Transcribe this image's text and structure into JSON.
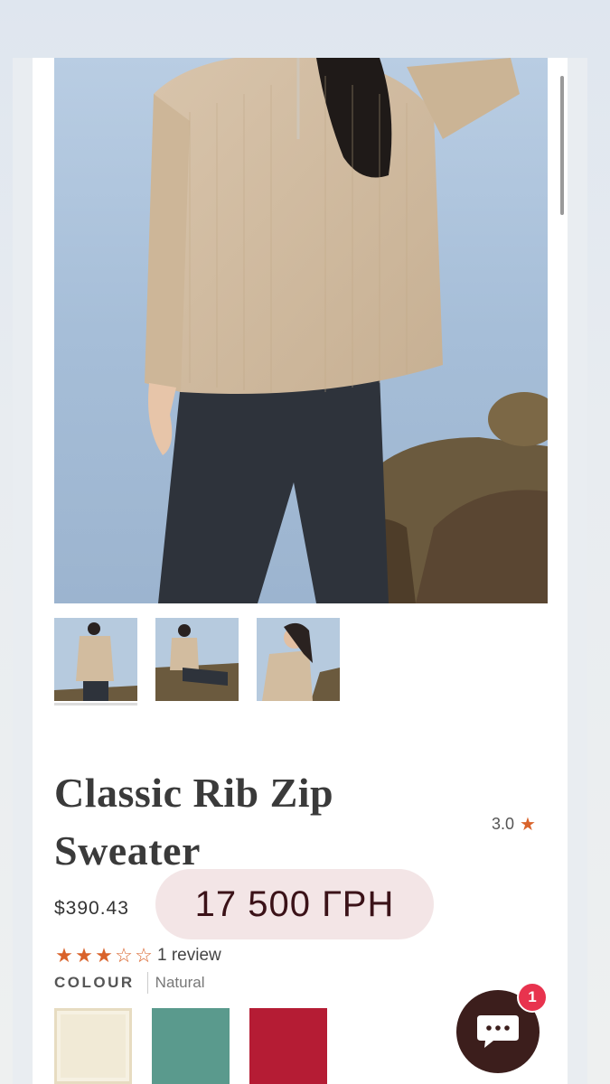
{
  "product": {
    "title": "Classic Rib Zip Sweater",
    "rating_value": "3.0",
    "price": "$390.43",
    "price_overlay": "17 500 ГРН",
    "stars_filled": 3,
    "stars_total": 5,
    "review_count_text": "1 review",
    "colour_label": "COLOUR",
    "colour_value": "Natural"
  },
  "gallery": {
    "main_image_icon": "model-wearing-sweater-photo",
    "thumbnails": [
      "thumbnail-standing",
      "thumbnail-sitting",
      "thumbnail-closeup"
    ]
  },
  "swatches": [
    {
      "name": "Natural",
      "color": "#f1ead6"
    },
    {
      "name": "Sage",
      "color": "#5a9a8d"
    },
    {
      "name": "Red",
      "color": "#b51c34"
    }
  ],
  "chat": {
    "badge_count": "1",
    "icon": "chat-bubble-icon"
  },
  "colors": {
    "accent_star": "#d9632b",
    "price_badge_bg": "#f3e5e6",
    "chat_bg": "#3c1e1c",
    "badge_red": "#e8334e"
  }
}
